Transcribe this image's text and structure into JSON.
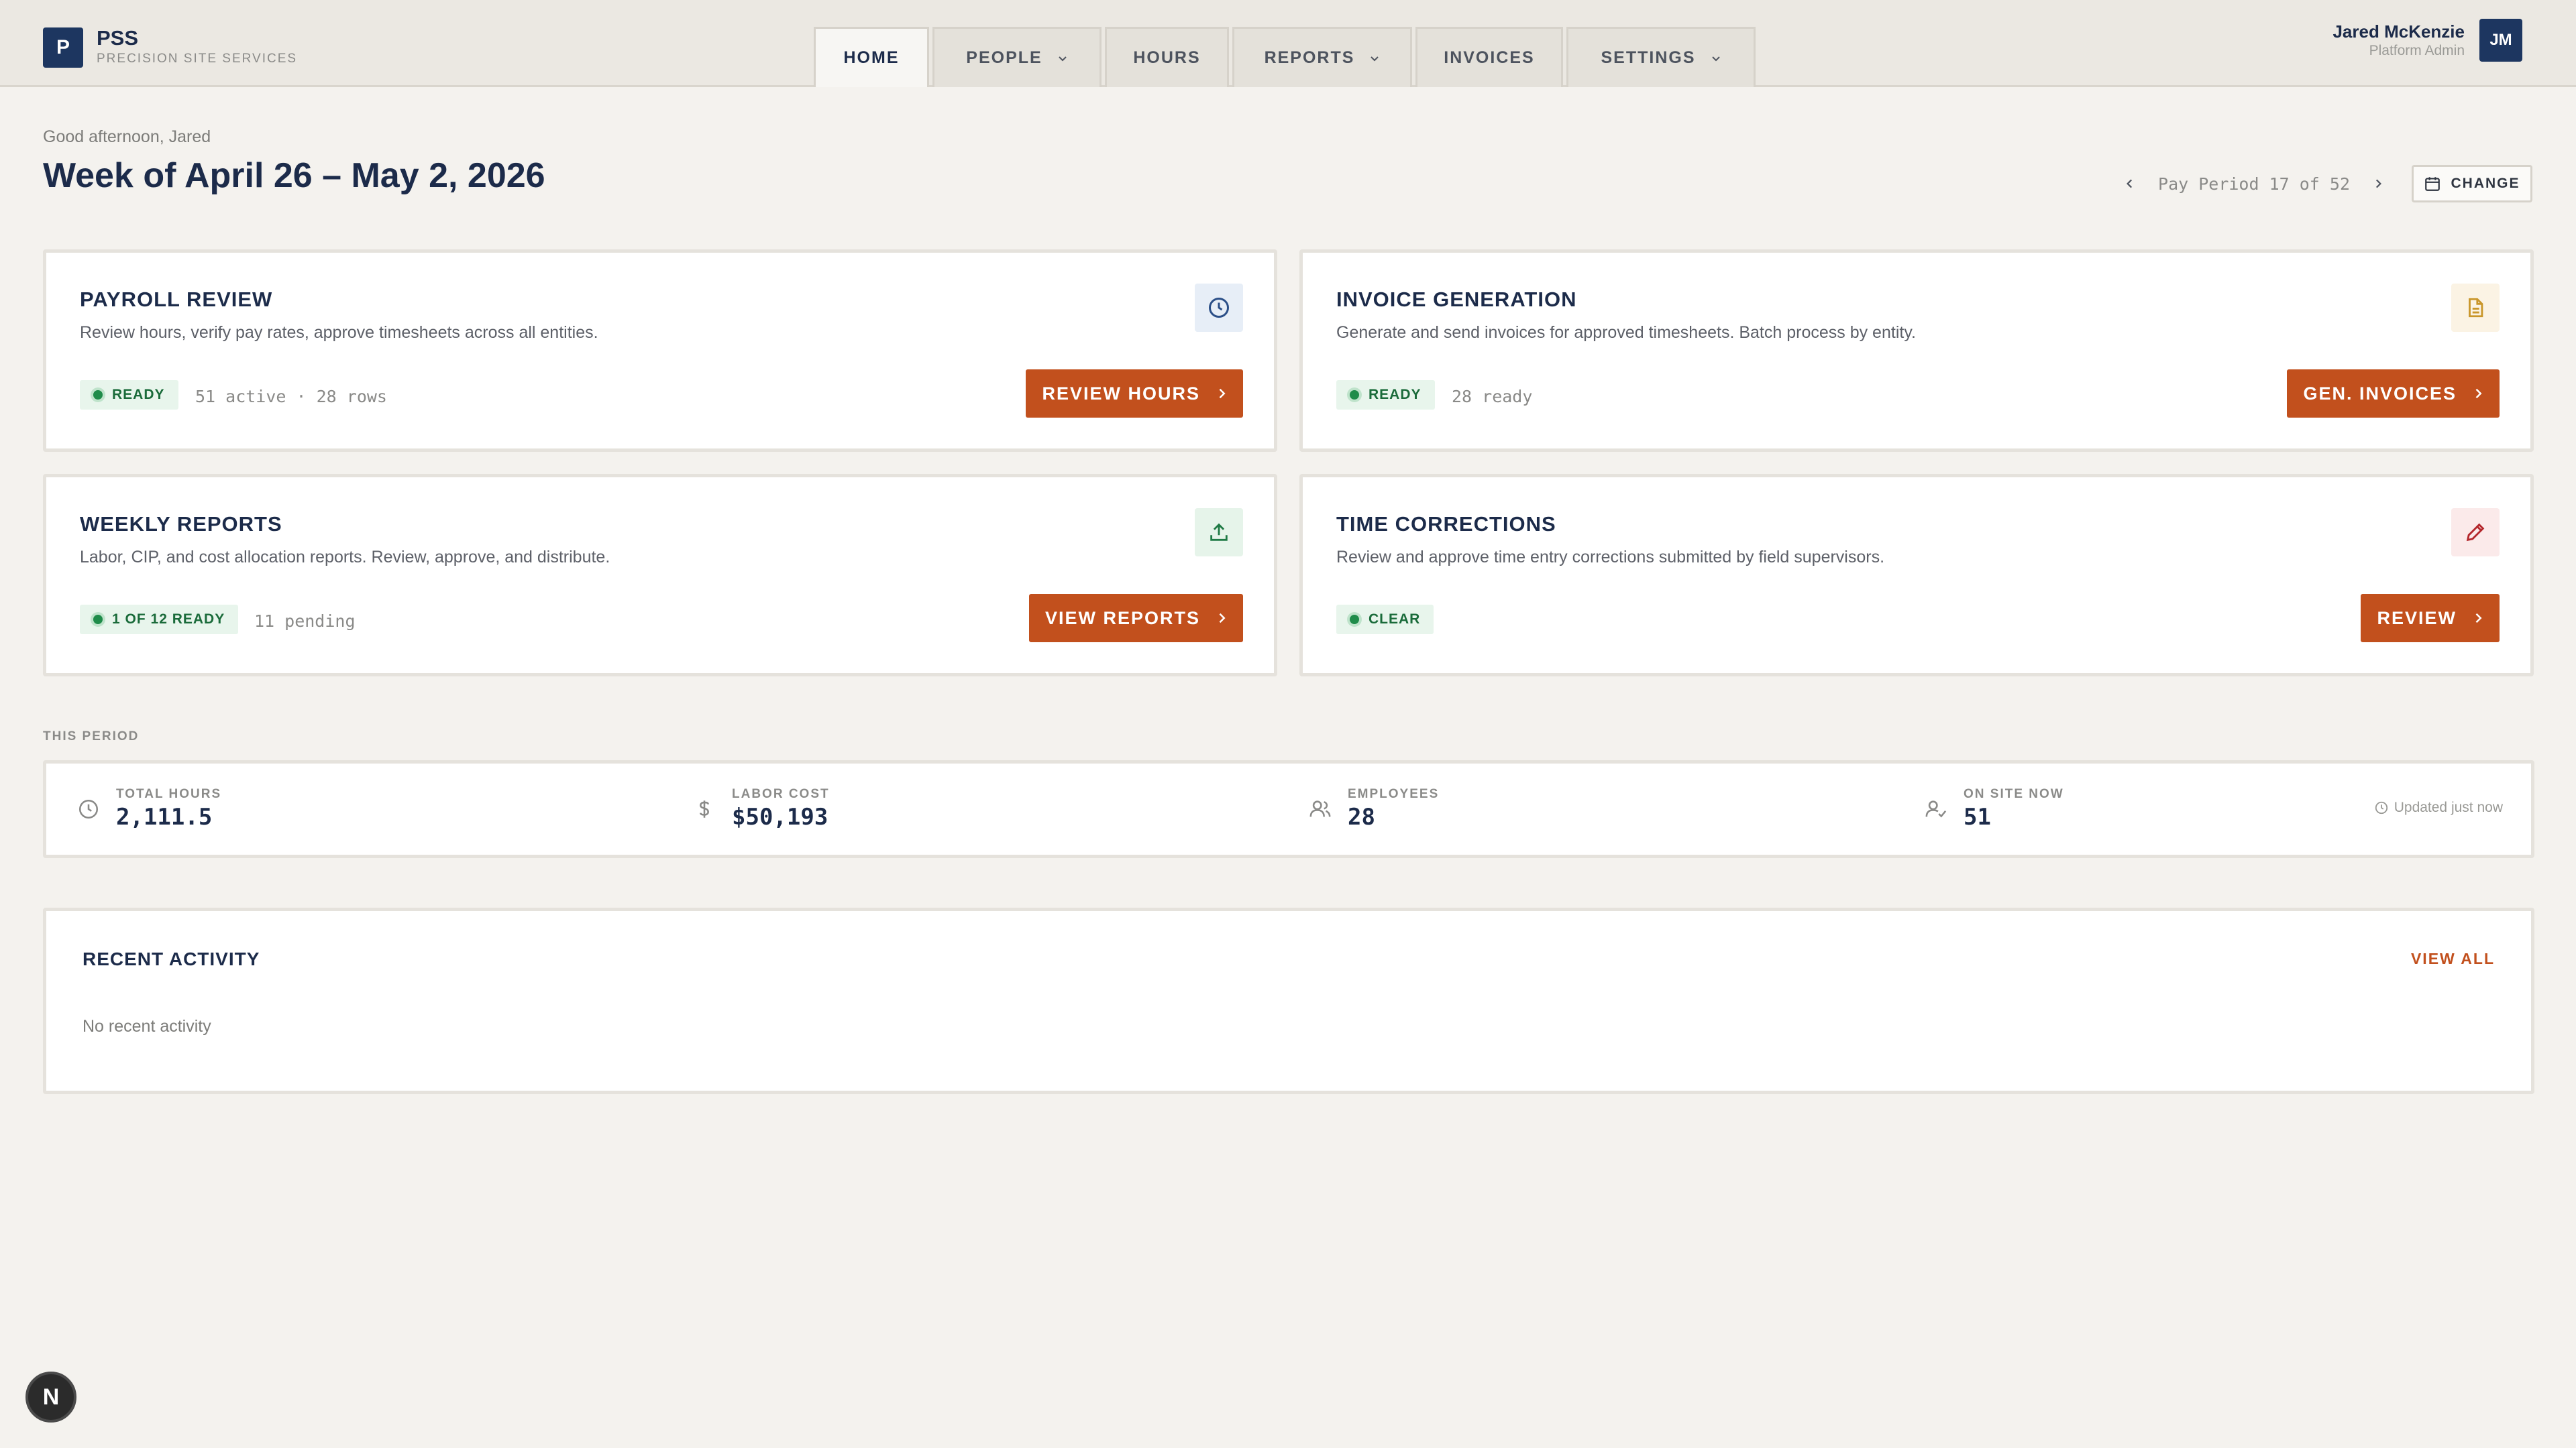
{
  "brand": {
    "logo_letter": "P",
    "name": "PSS",
    "subtitle": "PRECISION SITE SERVICES"
  },
  "nav": {
    "tabs": [
      {
        "label": "HOME",
        "active": true,
        "dropdown": false
      },
      {
        "label": "PEOPLE",
        "active": false,
        "dropdown": true
      },
      {
        "label": "HOURS",
        "active": false,
        "dropdown": false
      },
      {
        "label": "REPORTS",
        "active": false,
        "dropdown": true
      },
      {
        "label": "INVOICES",
        "active": false,
        "dropdown": false
      },
      {
        "label": "SETTINGS",
        "active": false,
        "dropdown": true
      }
    ]
  },
  "user": {
    "name": "Jared McKenzie",
    "role": "Platform Admin",
    "initials": "JM"
  },
  "header": {
    "greeting": "Good afternoon, Jared",
    "title": "Week of April 26 – May 2, 2026",
    "period_text": "Pay Period 17 of 52",
    "change_label": "CHANGE"
  },
  "cards": {
    "payroll": {
      "title": "PAYROLL REVIEW",
      "description": "Review hours, verify pay rates, approve timesheets across all entities.",
      "badge": "READY",
      "meta": "51 active · 28 rows",
      "button": "REVIEW HOURS",
      "icon": "clock-icon"
    },
    "invoice": {
      "title": "INVOICE GENERATION",
      "description": "Generate and send invoices for approved timesheets. Batch process by entity.",
      "badge": "READY",
      "meta": "28 ready",
      "button": "GEN. INVOICES",
      "icon": "document-icon"
    },
    "reports": {
      "title": "WEEKLY REPORTS",
      "description": "Labor, CIP, and cost allocation reports. Review, approve, and distribute.",
      "badge": "1 OF 12 READY",
      "meta": "11 pending",
      "button": "VIEW REPORTS",
      "icon": "upload-icon"
    },
    "corrections": {
      "title": "TIME CORRECTIONS",
      "description": "Review and approve time entry corrections submitted by field supervisors.",
      "badge": "CLEAR",
      "meta": "",
      "button": "REVIEW",
      "icon": "pencil-icon"
    }
  },
  "stats": {
    "section_label": "THIS PERIOD",
    "items": [
      {
        "label": "TOTAL HOURS",
        "value": "2,111.5",
        "icon": "clock-icon"
      },
      {
        "label": "LABOR COST",
        "value": "$50,193",
        "icon": "dollar-icon"
      },
      {
        "label": "EMPLOYEES",
        "value": "28",
        "icon": "users-icon"
      },
      {
        "label": "ON SITE NOW",
        "value": "51",
        "icon": "user-check-icon"
      }
    ],
    "updated": "Updated just now"
  },
  "activity": {
    "title": "RECENT ACTIVITY",
    "view_all": "VIEW ALL",
    "empty": "No recent activity"
  },
  "fab": {
    "letter": "N"
  },
  "colors": {
    "accent": "#c2501d",
    "navy": "#1d3660",
    "ready_green": "#1a6b3a",
    "ready_bg": "#e8f5ec"
  }
}
